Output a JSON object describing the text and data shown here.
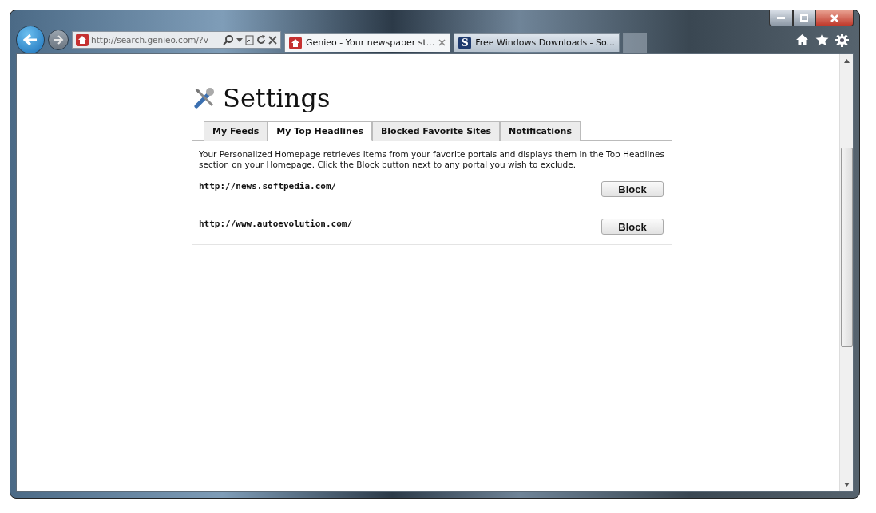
{
  "browser": {
    "address": "http://search.genieo.com/?v",
    "tabs": [
      {
        "title": "Genieo - Your newspaper st...",
        "selected": true
      },
      {
        "title": "Free Windows Downloads - So...",
        "selected": false,
        "favicon_text": "S"
      }
    ]
  },
  "page": {
    "title": "Settings",
    "tabs": [
      {
        "label": "My Feeds",
        "selected": false
      },
      {
        "label": "My Top Headlines",
        "selected": true
      },
      {
        "label": "Blocked Favorite Sites",
        "selected": false
      },
      {
        "label": "Notifications",
        "selected": false
      }
    ],
    "description": "Your Personalized Homepage retrieves items from your favorite portals and displays them in the Top Headlines section on your Homepage. Click the Block button next to any portal you wish to exclude.",
    "portals": [
      {
        "url": "http://news.softpedia.com/",
        "button": "Block"
      },
      {
        "url": "http://www.autoevolution.com/",
        "button": "Block"
      }
    ]
  }
}
